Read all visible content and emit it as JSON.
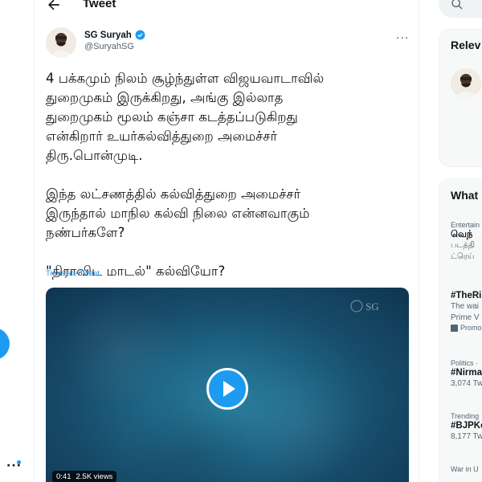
{
  "header": {
    "title": "Tweet"
  },
  "tweet": {
    "author_name": "SG Suryah",
    "author_handle": "@SuryahSG",
    "paragraphs": [
      "4 பக்கமும் நிலம் சூழ்ந்துள்ள விஜயவாடாவில்\nதுறைமுகம் இருக்கிறது, அங்கு இல்லாத\nதுறைமுகம் மூலம் கஞ்சா கடத்தப்படுகிறது\nஎன்கிறார் உயர்கல்வித்துறை அமைச்சர்\nதிரு.பொன்முடி.",
      "இந்த லட்சணத்தில் கல்வித்துறை அமைச்சர்\nஇருந்தால் மாநில கல்வி நிலை என்னவாகும்\nநண்பர்களே?",
      "\"திராவிட மாடல்\" கல்வியோ?"
    ],
    "translate_label": "Translate Tweet",
    "video": {
      "duration": "0:41",
      "views": "2.5K views",
      "watermark": "SG"
    }
  },
  "sidebar": {
    "relevant_title": "Relev",
    "whats_title": "What",
    "trends": [
      {
        "meta": "Entertain",
        "name": "வெந்",
        "sub": "படத்தி\nட்ரெய்"
      },
      {
        "meta": "",
        "name": "#TheRi",
        "sub": "The wai\nPrime V",
        "promo": "Promo"
      },
      {
        "meta": "Politics ·",
        "name": "#Nirma",
        "sub": "3,074 Tw"
      },
      {
        "meta": "Trending",
        "name": "#BJPKe",
        "sub": "8,177 Tw"
      },
      {
        "meta": "War in U",
        "name": "",
        "sub": ""
      }
    ]
  },
  "colors": {
    "accent": "#1d9bf0",
    "text": "#0f1419",
    "muted": "#536471"
  }
}
